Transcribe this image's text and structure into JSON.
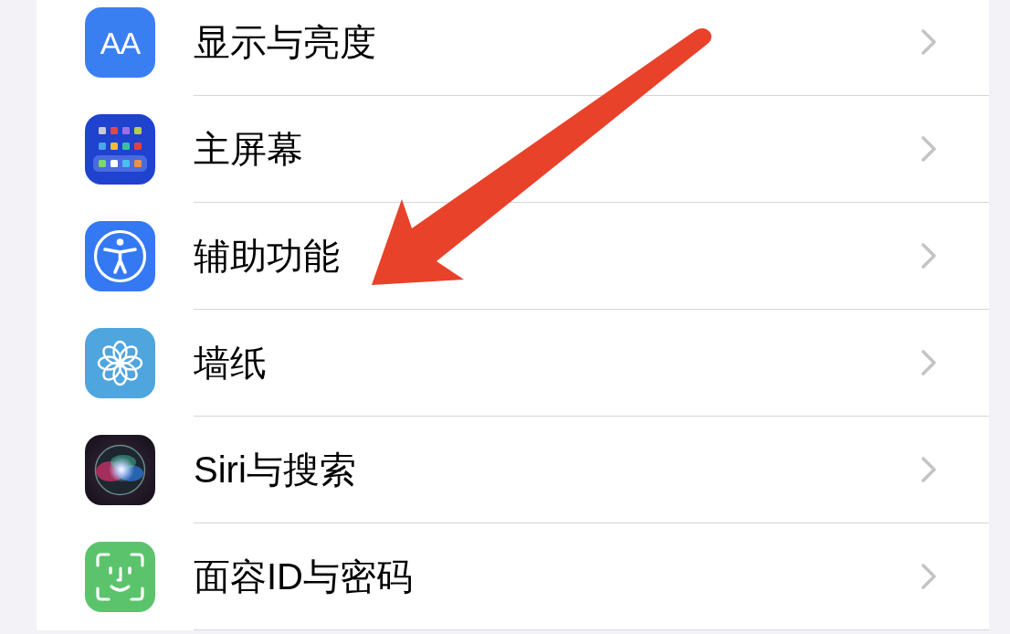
{
  "settings_list": {
    "items": [
      {
        "kind": "display",
        "icon_text": "AA",
        "label": "显示与亮度"
      },
      {
        "kind": "home_screen",
        "label": "主屏幕"
      },
      {
        "kind": "accessibility",
        "label": "辅助功能"
      },
      {
        "kind": "wallpaper",
        "label": "墙纸"
      },
      {
        "kind": "siri",
        "label": "Siri与搜索"
      },
      {
        "kind": "face_id",
        "label": "面容ID与密码"
      }
    ]
  },
  "annotations": [
    {
      "kind": "arrow"
    }
  ]
}
